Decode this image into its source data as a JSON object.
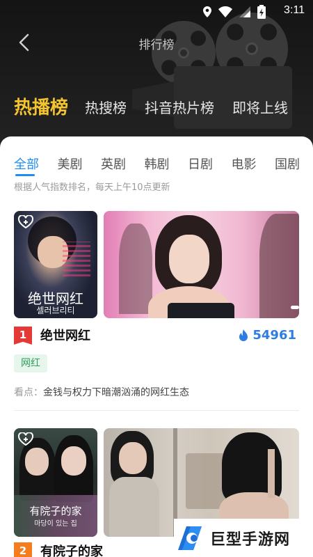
{
  "status_bar": {
    "time": "3:11"
  },
  "header": {
    "title": "排行榜"
  },
  "rank_tabs": [
    {
      "label": "热播榜"
    },
    {
      "label": "热搜榜"
    },
    {
      "label": "抖音热片榜"
    },
    {
      "label": "即将上线"
    }
  ],
  "genre_tabs": [
    {
      "label": "全部"
    },
    {
      "label": "美剧"
    },
    {
      "label": "英剧"
    },
    {
      "label": "韩剧"
    },
    {
      "label": "日剧"
    },
    {
      "label": "电影"
    },
    {
      "label": "国剧"
    }
  ],
  "hint": "根据人气指数排名，每天上午10点更新",
  "items": [
    {
      "rank": "1",
      "title": "绝世网红",
      "heat": "54961",
      "tag": "网红",
      "desc_label": "看点：",
      "desc": "金钱与权力下暗潮汹涌的网红生态",
      "poster_title": "绝世网红",
      "poster_sub": "셀러브리티"
    },
    {
      "rank": "2",
      "title": "有院子的家",
      "poster_title": "有院子的家",
      "poster_sub": "마당이 있는 집"
    }
  ],
  "watermark": {
    "text": "巨型手游网"
  },
  "colors": {
    "accent_blue": "#1e8ef5",
    "active_rank_tab": "#f4c430",
    "rank1_badge": "#e53935",
    "rank2_badge": "#f57c1f",
    "tag_green": "#2e9e58",
    "heat_blue": "#2f7de1"
  },
  "icons": [
    "location-icon",
    "wifi-icon",
    "signal-icon",
    "battery-icon",
    "back-icon",
    "heart-plus-icon",
    "flame-icon"
  ]
}
